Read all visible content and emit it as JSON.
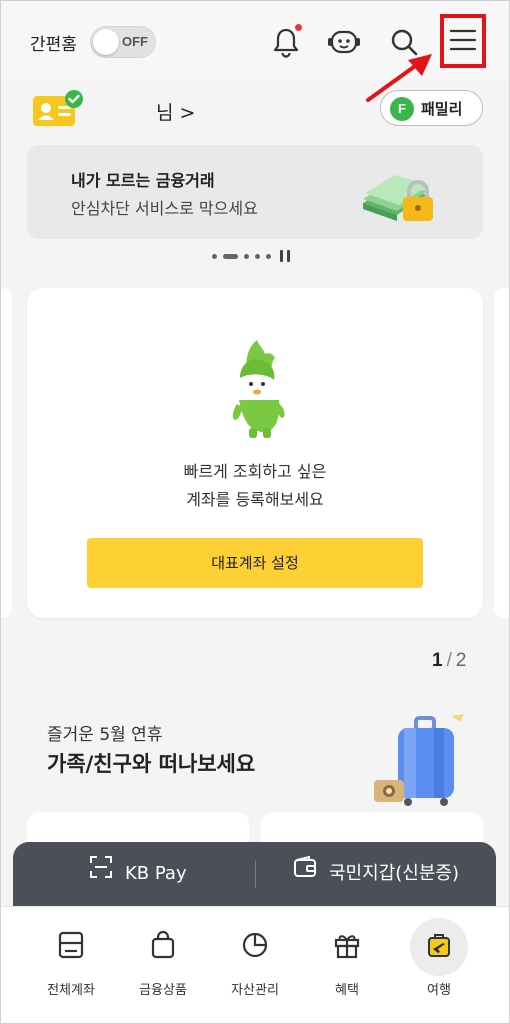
{
  "header": {
    "simple_home_label": "간편홈",
    "toggle_state": "OFF",
    "icons": [
      "bell-icon",
      "chatbot-icon",
      "search-icon",
      "menu-icon"
    ],
    "notification_dot_color": "#e53935",
    "highlight_color": "#e2141a"
  },
  "user": {
    "name_suffix": "님 >",
    "family_badge": "F",
    "family_label": "패밀리"
  },
  "banner": {
    "title": "내가 모르는 금융거래",
    "subtitle": "안심차단 서비스로 막으세요"
  },
  "account_card": {
    "line1": "빠르게 조회하고 싶은",
    "line2": "계좌를 등록해보세요",
    "button_label": "대표계좌 설정",
    "button_color": "#fdd033"
  },
  "pager": {
    "current": "1",
    "separator": "/",
    "total": "2"
  },
  "promo": {
    "subtitle": "즐거운 5월 연휴",
    "title": "가족/친구와 떠나보세요"
  },
  "paybar": {
    "kb_pay_label": "KB Pay",
    "wallet_label": "국민지갑(신분증)"
  },
  "bottom_nav": {
    "items": [
      {
        "label": "전체계좌",
        "icon": "account-card-icon"
      },
      {
        "label": "금융상품",
        "icon": "shopping-bag-icon"
      },
      {
        "label": "자산관리",
        "icon": "pie-chart-icon"
      },
      {
        "label": "혜택",
        "icon": "gift-icon"
      },
      {
        "label": "여행",
        "icon": "travel-icon",
        "active": true
      }
    ]
  }
}
